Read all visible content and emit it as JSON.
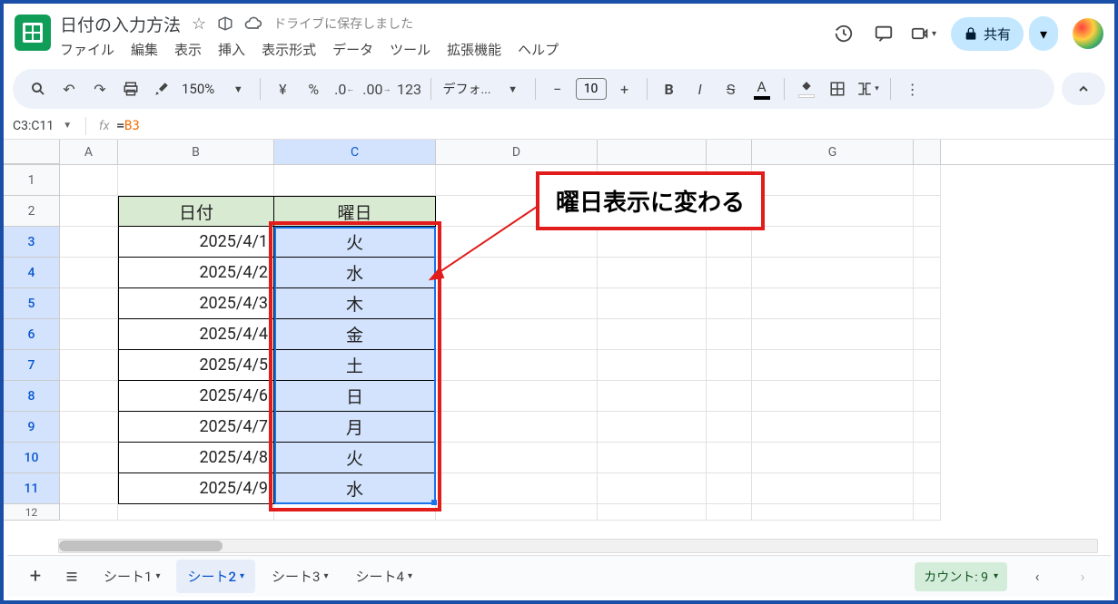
{
  "title": {
    "doc_name": "日付の入力方法",
    "save_status": "ドライブに保存しました"
  },
  "menus": [
    "ファイル",
    "編集",
    "表示",
    "挿入",
    "表示形式",
    "データ",
    "ツール",
    "拡張機能",
    "ヘルプ"
  ],
  "share": {
    "label": "共有"
  },
  "toolbar": {
    "zoom": "150%",
    "font": "デフォ...",
    "font_size": "10"
  },
  "namebox": "C3:C11",
  "formula": "=B3",
  "columns": [
    "A",
    "B",
    "C",
    "D",
    "",
    "",
    "G",
    ""
  ],
  "rows": [
    "1",
    "2",
    "3",
    "4",
    "5",
    "6",
    "7",
    "8",
    "9",
    "10",
    "11",
    "12"
  ],
  "table": {
    "headers": {
      "b": "日付",
      "c": "曜日"
    },
    "data": [
      {
        "b": "2025/4/1",
        "c": "火"
      },
      {
        "b": "2025/4/2",
        "c": "水"
      },
      {
        "b": "2025/4/3",
        "c": "木"
      },
      {
        "b": "2025/4/4",
        "c": "金"
      },
      {
        "b": "2025/4/5",
        "c": "土"
      },
      {
        "b": "2025/4/6",
        "c": "日"
      },
      {
        "b": "2025/4/7",
        "c": "月"
      },
      {
        "b": "2025/4/8",
        "c": "火"
      },
      {
        "b": "2025/4/9",
        "c": "水"
      }
    ]
  },
  "annotation": {
    "callout": "曜日表示に変わる"
  },
  "sheets": {
    "items": [
      {
        "label": "シート1",
        "active": false
      },
      {
        "label": "シート2",
        "active": true
      },
      {
        "label": "シート3",
        "active": false
      },
      {
        "label": "シート4",
        "active": false
      }
    ]
  },
  "status": {
    "count_label": "カウント: 9"
  }
}
